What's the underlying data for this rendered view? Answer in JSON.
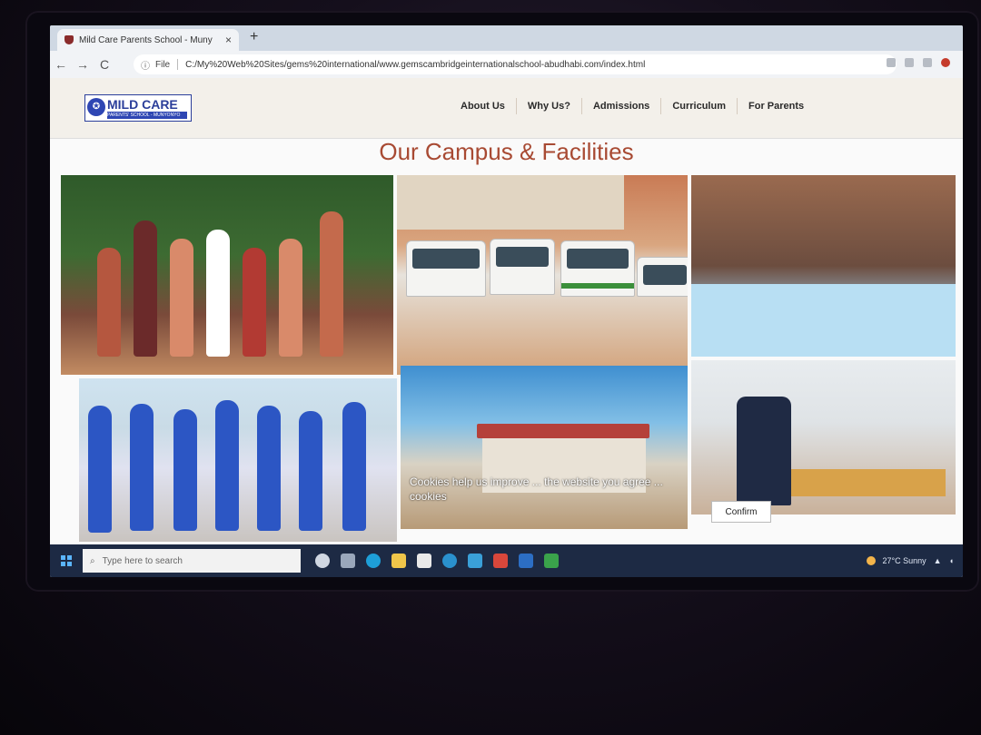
{
  "browser": {
    "tab_title": "Mild Care Parents School - Muny",
    "tab_close": "×",
    "new_tab": "+",
    "nav": {
      "back": "←",
      "forward": "→",
      "reload": "C"
    },
    "address_label": "File",
    "url": "C:/My%20Web%20Sites/gems%20international/www.gemscambridgeinternationalschool-abudhabi.com/index.html"
  },
  "site": {
    "logo_name": "MILD CARE",
    "logo_subtitle": "PARENTS' SCHOOL - MUNYONYO",
    "nav_items": [
      "About Us",
      "Why Us?",
      "Admissions",
      "Curriculum",
      "For Parents"
    ],
    "section_title": "Our Campus & Facilities",
    "tile_caption": "Cookies help us improve ... the website you agree ... cookies",
    "confirm_label": "Confirm"
  },
  "taskbar": {
    "search_placeholder": "Type here to search",
    "weather": "27°C Sunny"
  },
  "colors": {
    "accent_title": "#a84a33",
    "logo_blue": "#2b3e9a",
    "taskbar": "#1d2a44"
  }
}
